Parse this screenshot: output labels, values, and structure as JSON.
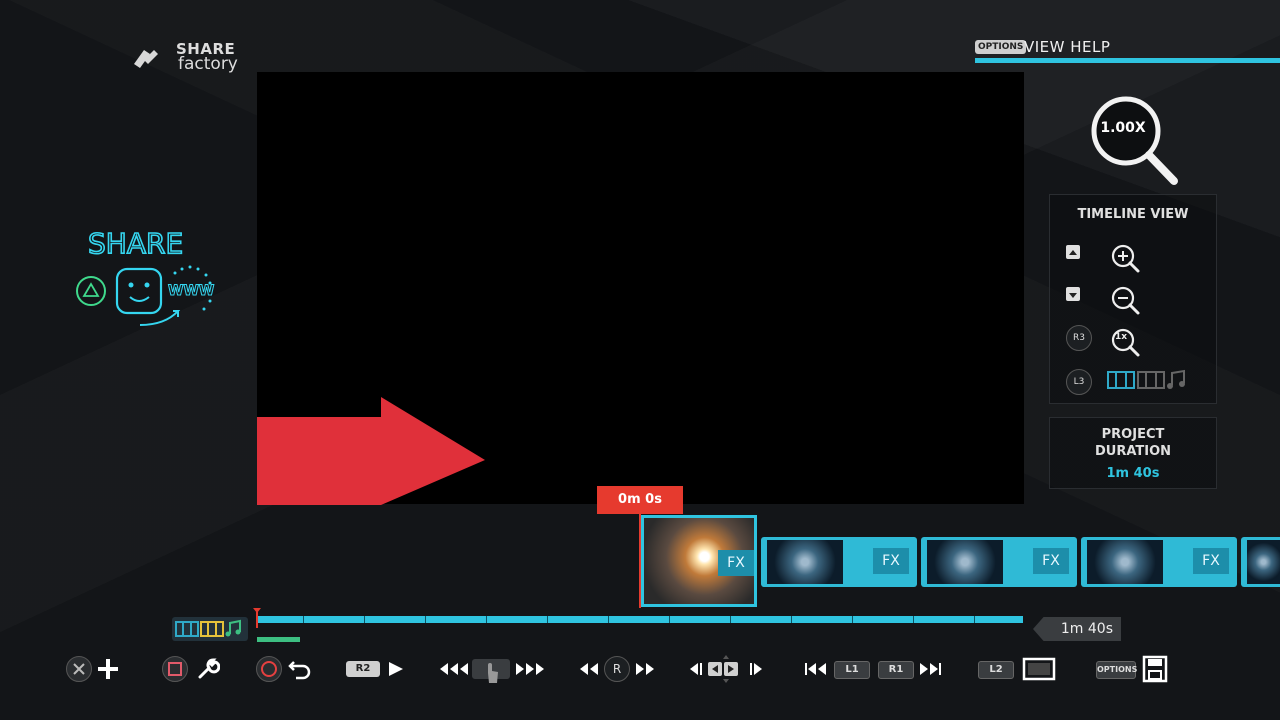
{
  "app": {
    "logo_line1": "SHARE",
    "logo_line2": "factory"
  },
  "help": {
    "options_key": "OPTIONS",
    "label": "VIEW HELP"
  },
  "zoom": {
    "level": "1.00X"
  },
  "timeline_view": {
    "title": "TIMELINE VIEW",
    "zoom_in_icon": "zoom-in-icon",
    "zoom_out_icon": "zoom-out-icon",
    "reset_key": "R3",
    "reset_label": "1x",
    "track_key": "L3"
  },
  "project_duration": {
    "label_line1": "PROJECT",
    "label_line2": "DURATION",
    "value": "1m 40s"
  },
  "playhead": {
    "time": "0m 0s"
  },
  "clips": [
    {
      "fx": "FX"
    },
    {
      "fx": "FX"
    },
    {
      "fx": "FX"
    },
    {
      "fx": "FX"
    }
  ],
  "timeline": {
    "end_time": "1m 40s"
  },
  "controls": {
    "r2": "R2",
    "r_stick": "R",
    "l1": "L1",
    "r1": "R1",
    "l2": "L2",
    "options": "OPTIONS"
  },
  "colors": {
    "accent": "#2fc4e0",
    "playhead": "#e63a2e",
    "arrow": "#e0303a"
  }
}
